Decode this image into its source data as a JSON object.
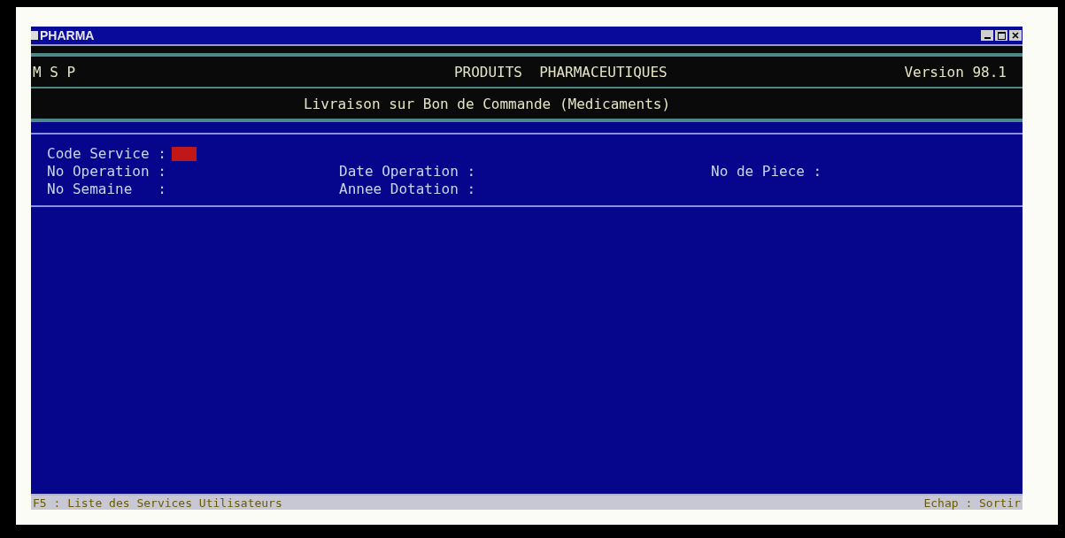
{
  "window": {
    "title": "PHARMA"
  },
  "header": {
    "left": "M S P",
    "center": "PRODUITS  PHARMACEUTIQUES",
    "right": "Version 98.1"
  },
  "subtitle": "Livraison sur Bon de Commande (Medicaments)",
  "form_rows": [
    {
      "fields": [
        {
          "label": "Code Service :",
          "kind": "input"
        }
      ]
    },
    {
      "fields": [
        {
          "label": "No Operation :",
          "kind": "plain"
        },
        {
          "label": "Date Operation :",
          "kind": "plain"
        },
        {
          "label": "No de Piece :",
          "kind": "plain"
        }
      ]
    },
    {
      "fields": [
        {
          "label": "No Semaine   :",
          "kind": "plain"
        },
        {
          "label": "Annee Dotation :",
          "kind": "plain"
        }
      ]
    }
  ],
  "status_bar": {
    "left": "F5 : Liste des Services Utilisateurs",
    "right": "Echap : Sortir"
  }
}
